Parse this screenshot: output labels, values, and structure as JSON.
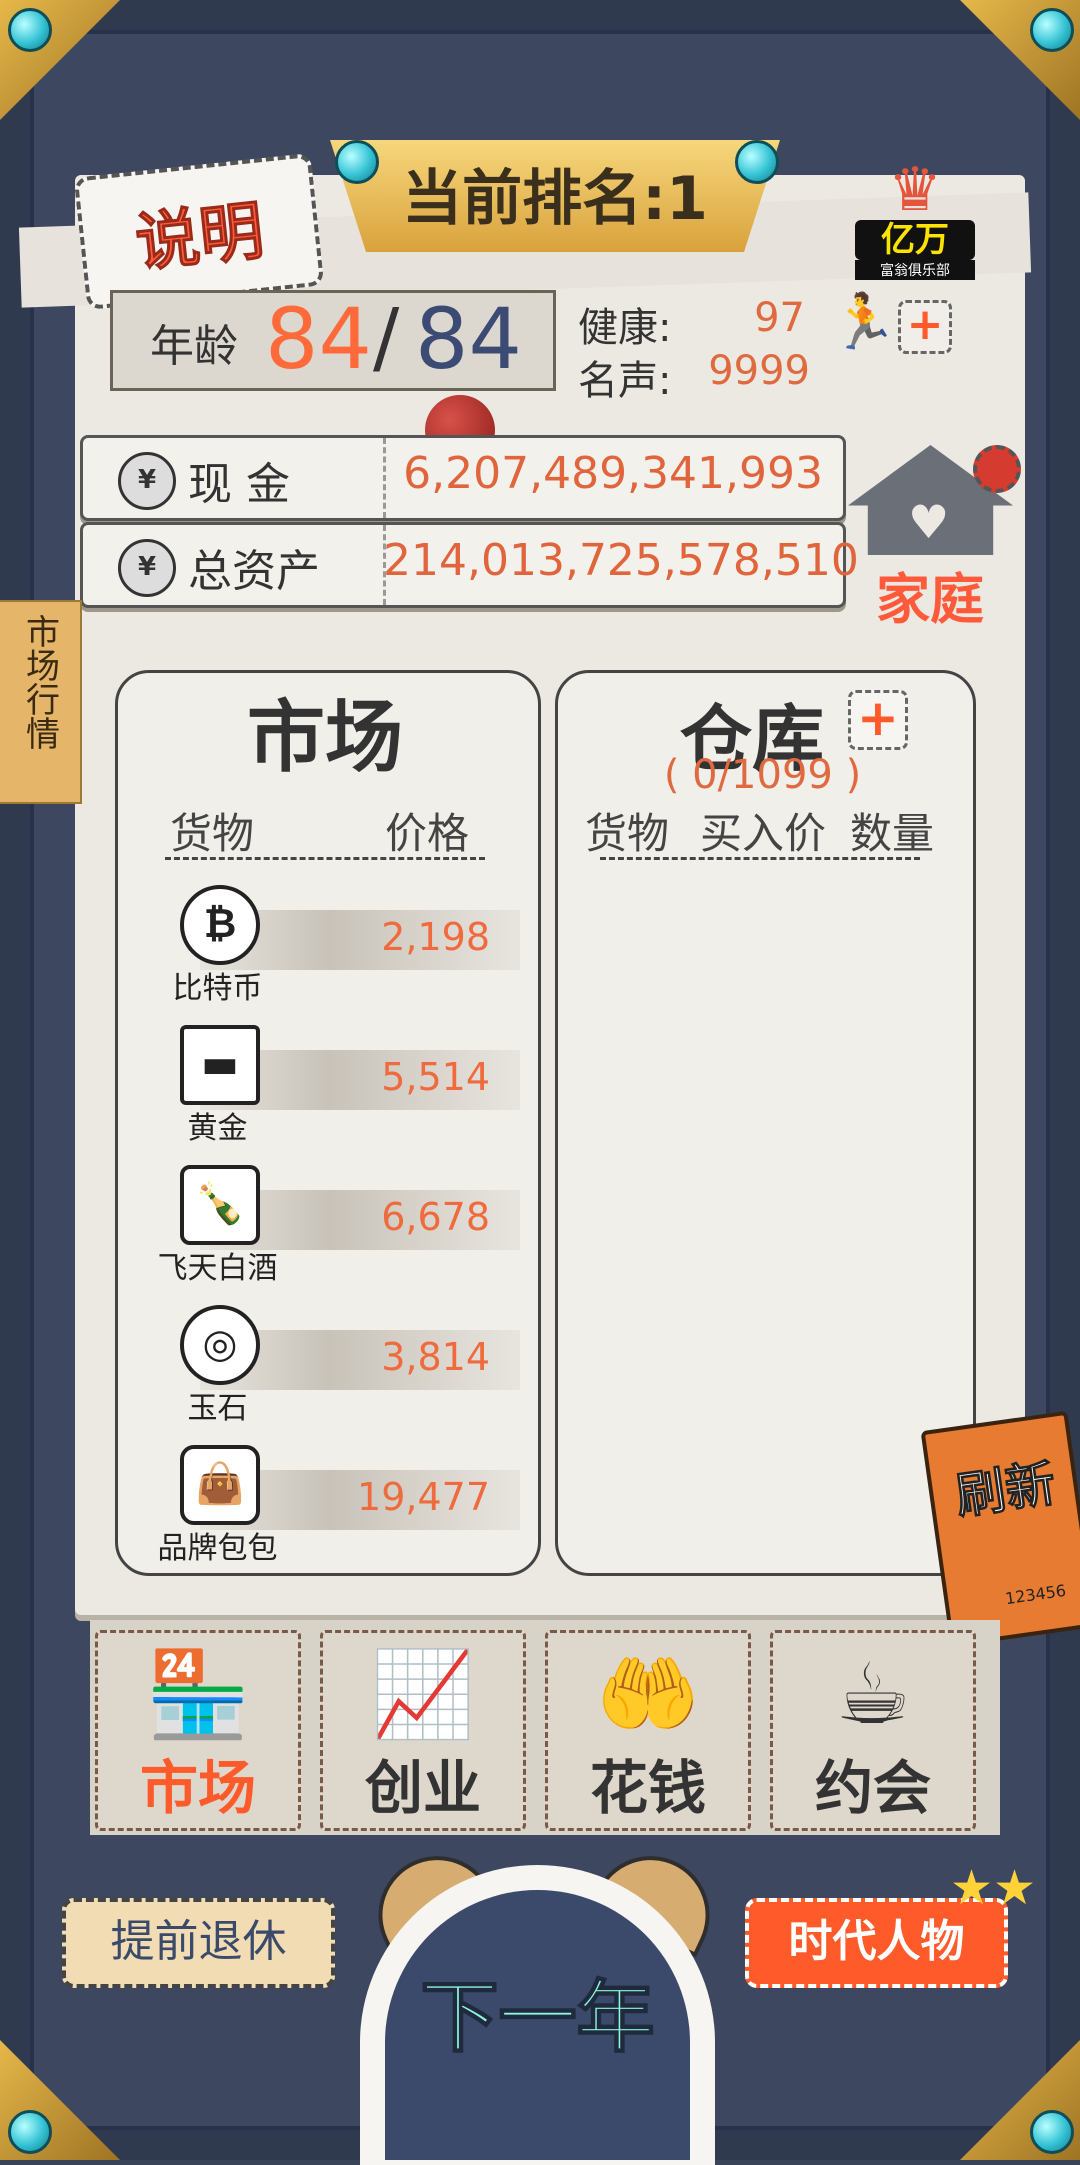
{
  "header": {
    "rank_title": "当前排名:1",
    "help_label": "说明",
    "club_crown": "♛",
    "club_name": "亿万",
    "club_subtitle": "富翁俱乐部"
  },
  "stats": {
    "age_label": "年龄",
    "age_current": "84",
    "age_separator": "/",
    "age_max": "84",
    "health_label": "健康:",
    "health_value": "97",
    "fame_label": "名声:",
    "fame_value": "9999",
    "plus_symbol": "+",
    "person_icon": "🏃"
  },
  "money": {
    "cash_label": "现 金",
    "cash_value": "6,207,489,341,993",
    "assets_label": "总资产",
    "assets_value": "214,013,725,578,510",
    "coin_glyph": "¥"
  },
  "home": {
    "label": "家庭",
    "heart": "♥"
  },
  "side_tab": {
    "label": "市场行情"
  },
  "market": {
    "title": "市场",
    "col_goods": "货物",
    "col_price": "价格",
    "items": [
      {
        "name": "比特币",
        "price": "2,198",
        "icon": "₿"
      },
      {
        "name": "黄金",
        "price": "5,514",
        "icon": "▬"
      },
      {
        "name": "飞天白酒",
        "price": "6,678",
        "icon": "🍾"
      },
      {
        "name": "玉石",
        "price": "3,814",
        "icon": "◎"
      },
      {
        "name": "品牌包包",
        "price": "19,477",
        "icon": "👜"
      }
    ]
  },
  "storage": {
    "title": "仓库",
    "plus": "+",
    "capacity": "( 0/1099 )",
    "col_goods": "货物",
    "col_buy_price": "买入价",
    "col_qty": "数量"
  },
  "refresh": {
    "label": "刷新",
    "code": "123456"
  },
  "tabs": [
    {
      "label": "市场",
      "icon": "🏪"
    },
    {
      "label": "创业",
      "icon": "📈"
    },
    {
      "label": "花钱",
      "icon": "🤲"
    },
    {
      "label": "约会",
      "icon": "☕"
    }
  ],
  "bottom": {
    "retire_label": "提前退休",
    "next_year_label": "下一年",
    "figures_label": "时代人物",
    "stars": "★★"
  },
  "colors": {
    "accent_orange": "#ff5a2a",
    "value_orange": "#e0643c",
    "navy": "#3b4a6a",
    "gold": "#e6b84a"
  }
}
